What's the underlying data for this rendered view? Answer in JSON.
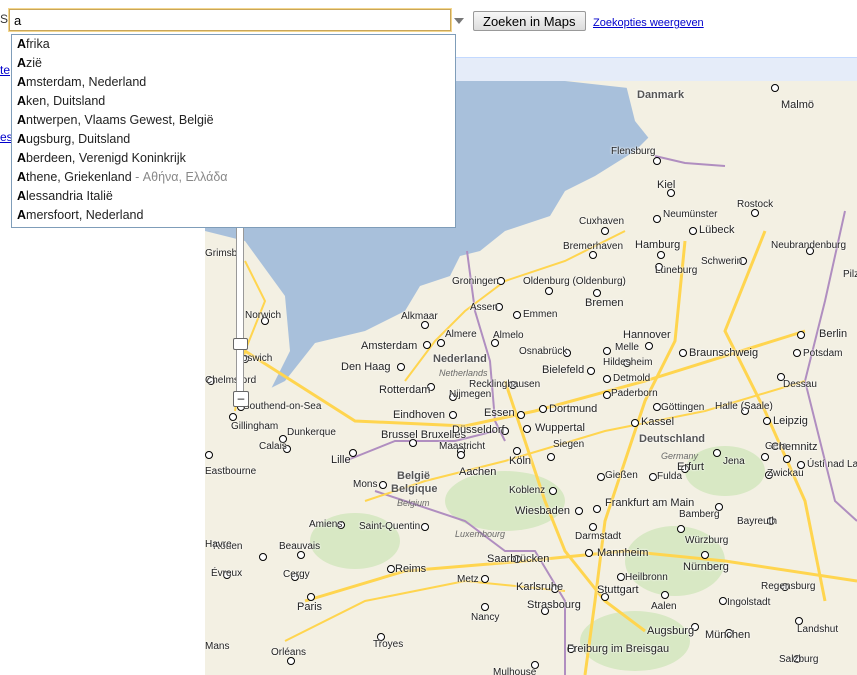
{
  "search": {
    "query": "a",
    "button_label": "Zoeken in Maps",
    "options_link": "Zoekopties weergeven",
    "edge_char": "S"
  },
  "left_stub": {
    "link1": "te",
    "link2": "es"
  },
  "autocomplete": [
    {
      "bold": "A",
      "rest": "frika",
      "extra": ""
    },
    {
      "bold": "A",
      "rest": "zië",
      "extra": ""
    },
    {
      "bold": "A",
      "rest": "msterdam, Nederland",
      "extra": ""
    },
    {
      "bold": "A",
      "rest": "ken, Duitsland",
      "extra": ""
    },
    {
      "bold": "A",
      "rest": "ntwerpen, Vlaams Gewest, België",
      "extra": ""
    },
    {
      "bold": "A",
      "rest": "ugsburg, Duitsland",
      "extra": ""
    },
    {
      "bold": "A",
      "rest": "berdeen, Verenigd Koninkrijk",
      "extra": ""
    },
    {
      "bold": "A",
      "rest": "thene, Griekenland",
      "extra": " - Αθήνα, Ελλάδα"
    },
    {
      "bold": "A",
      "rest": "lessandria Italië",
      "extra": ""
    },
    {
      "bold": "A",
      "rest": "mersfoort, Nederland",
      "extra": ""
    }
  ],
  "map": {
    "colors": {
      "sea": "#a8c0db",
      "land": "#f3f0e3",
      "road": "#ffd54f",
      "border": "#b08ec0"
    },
    "countries": [
      "Danmark",
      "Nederland",
      "Netherlands",
      "Deutschland",
      "Germany",
      "België",
      "Belgique",
      "Belgium",
      "Luxembourg"
    ],
    "cities": [
      "Malmö",
      "Flensburg",
      "Kiel",
      "Rostock",
      "Cuxhaven",
      "Neumünster",
      "Lübeck",
      "Bremerhaven",
      "Hamburg",
      "Neubrandenburg",
      "Schwerin",
      "Lüneburg",
      "Groningen",
      "Oldenburg (Oldenburg)",
      "Bremen",
      "Assen",
      "Emmen",
      "Alkmaar",
      "Almere",
      "Almelo",
      "Hannover",
      "Berlin",
      "Amsterdam",
      "Osnabrück",
      "Melle",
      "Braunschweig",
      "Den Haag",
      "Hildesheim",
      "Potsdam",
      "Bielefeld",
      "Detmold",
      "Rotterdam",
      "Recklinghausen",
      "Nijmegen",
      "Paderborn",
      "Dessau",
      "Eindhoven",
      "Essen",
      "Dortmund",
      "Göttingen",
      "Halle (Saale)",
      "Leipzig",
      "Brussel Bruxelles",
      "Düsseldorf",
      "Wuppertal",
      "Kassel",
      "Maastricht",
      "Siegen",
      "Gera",
      "Chemnitz",
      "Jena",
      "Lille",
      "Aachen",
      "Köln",
      "Erfurt",
      "Zwickau",
      "Mons",
      "Koblenz",
      "Gießen",
      "Fulda",
      "Wiesbaden",
      "Frankfurt am Main",
      "Bamberg",
      "Bayreuth",
      "Darmstadt",
      "Würzburg",
      "Saarbrücken",
      "Mannheim",
      "Nürnberg",
      "Reims",
      "Metz",
      "Heilbronn",
      "Regensburg",
      "Karlsruhe",
      "Stuttgart",
      "Ingolstadt",
      "Strasbourg",
      "Nancy",
      "Aalen",
      "Landshut",
      "Augsburg",
      "München",
      "Freiburg im Breisgau",
      "Salzburg",
      "Paris",
      "Amiens",
      "Saint-Quentin",
      "Rouen",
      "Beauvais",
      "Évreux",
      "Cergy",
      "Troyes",
      "Orléans",
      "Norwich",
      "Ipswich",
      "Chelmsford",
      "Southend-on-Sea",
      "Gillingham",
      "Dunkerque",
      "Calais",
      "Eastbourne",
      "Mulhouse",
      "Neubrandenburg",
      "Ústí nad Labem",
      "Pilzen",
      "Havre",
      "Grimsby",
      "Mans"
    ]
  }
}
